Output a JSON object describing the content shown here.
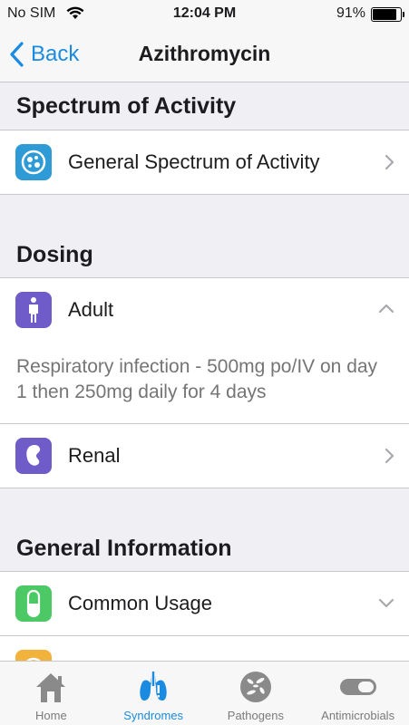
{
  "status_bar": {
    "carrier": "No SIM",
    "time": "12:04 PM",
    "battery": "91%"
  },
  "nav": {
    "back_label": "Back",
    "title": "Azithromycin"
  },
  "sections": {
    "spectrum": {
      "header": "Spectrum of Activity",
      "row_label": "General Spectrum of Activity",
      "icon": "petri-dish-icon"
    },
    "dosing": {
      "header": "Dosing",
      "adult": {
        "label": "Adult",
        "icon": "person-icon",
        "detail": "Respiratory infection - 500mg po/IV on day 1 then 250mg daily for 4 days"
      },
      "renal": {
        "label": "Renal",
        "icon": "kidney-icon"
      }
    },
    "general": {
      "header": "General Information",
      "common_usage": {
        "label": "Common Usage",
        "icon": "capsule-icon"
      }
    }
  },
  "tabs": [
    {
      "label": "Home",
      "icon": "home-icon"
    },
    {
      "label": "Syndromes",
      "icon": "lungs-icon",
      "active": true
    },
    {
      "label": "Pathogens",
      "icon": "pathogen-icon"
    },
    {
      "label": "Antimicrobials",
      "icon": "pill-icon"
    }
  ],
  "colors": {
    "accent": "#1a8be0",
    "spectrum_icon": "#2e9ad6",
    "adult_icon": "#6f5cc8",
    "renal_icon": "#6f5cc8",
    "usage_icon": "#4cc964",
    "partial_icon": "#f2b33d"
  }
}
